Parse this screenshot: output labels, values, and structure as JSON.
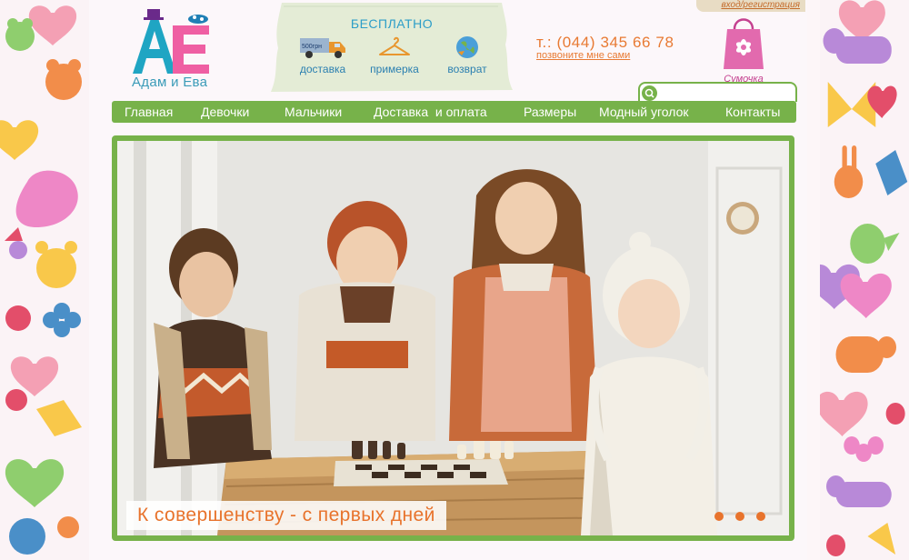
{
  "header": {
    "logo_text": "Адам и Ева",
    "logo_letters": "AE",
    "promo_title": "БЕСПЛАТНО",
    "promo_items": [
      {
        "icon": "delivery-truck-icon",
        "label": "доставка",
        "badge": "500грн"
      },
      {
        "icon": "hanger-icon",
        "label": "примерка"
      },
      {
        "icon": "globe-return-icon",
        "label": "возврат"
      }
    ],
    "phone": "т.: (044) 345 66 78",
    "callback": "позвоните мне сами",
    "login": "вход/регистрация",
    "cart_label": "Сумочка",
    "cart_icon": "shopping-bag-icon"
  },
  "search": {
    "placeholder": "",
    "icon": "search-icon"
  },
  "nav": [
    "Главная",
    "Девочки",
    "Мальчики",
    "Доставка  и оплата",
    "Размеры",
    "Модный уголок",
    "Контакты"
  ],
  "banner": {
    "caption": "К совершенству - с первых дней",
    "slides": 3
  },
  "colors": {
    "accent_green": "#77b24a",
    "accent_orange": "#e8732c",
    "brand_blue": "#2d9ec8",
    "brand_pink": "#c4408f"
  }
}
